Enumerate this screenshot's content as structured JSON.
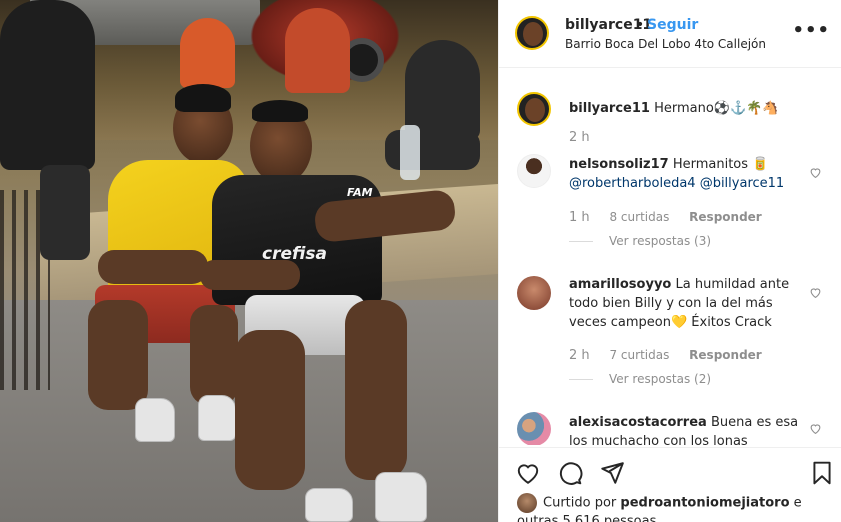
{
  "post": {
    "username": "billyarce11",
    "separator": "•",
    "follow_label": "Seguir",
    "location": "Barrio Boca Del Lobo 4to Callejón",
    "more_label": "•••"
  },
  "photo": {
    "jersey_sponsor_left": "crefisa",
    "jersey_brand": "FAM"
  },
  "caption": {
    "username": "billyarce11",
    "text": "Hermano⚽️⚓️🌴🐴",
    "time": "2 h"
  },
  "comments": [
    {
      "username": "nelsonsoliz17",
      "text": "Hermanitos 🥫",
      "mentions": "@robertharboleda4 @billyarce11",
      "time": "1 h",
      "likes": "8 curtidas",
      "reply_label": "Responder",
      "view_replies": "Ver respostas (3)"
    },
    {
      "username": "amarillosoyyo",
      "text": "La humildad ante todo bien Billy y con la del más veces campeon💛 Éxitos Crack",
      "time": "2 h",
      "likes": "7 curtidas",
      "reply_label": "Responder",
      "view_replies": "Ver respostas (2)"
    },
    {
      "username": "alexisacostacorrea",
      "text": "Buena es esa los muchacho con los lonas"
    }
  ],
  "likes_summary": {
    "prefix": "Curtido por",
    "user": "pedroantoniomejiatoro",
    "suffix": "e outras 5.616 pessoas"
  },
  "colors": {
    "link_blue": "#3897f0",
    "mention": "#00376b",
    "muted": "#8e8e8e"
  }
}
